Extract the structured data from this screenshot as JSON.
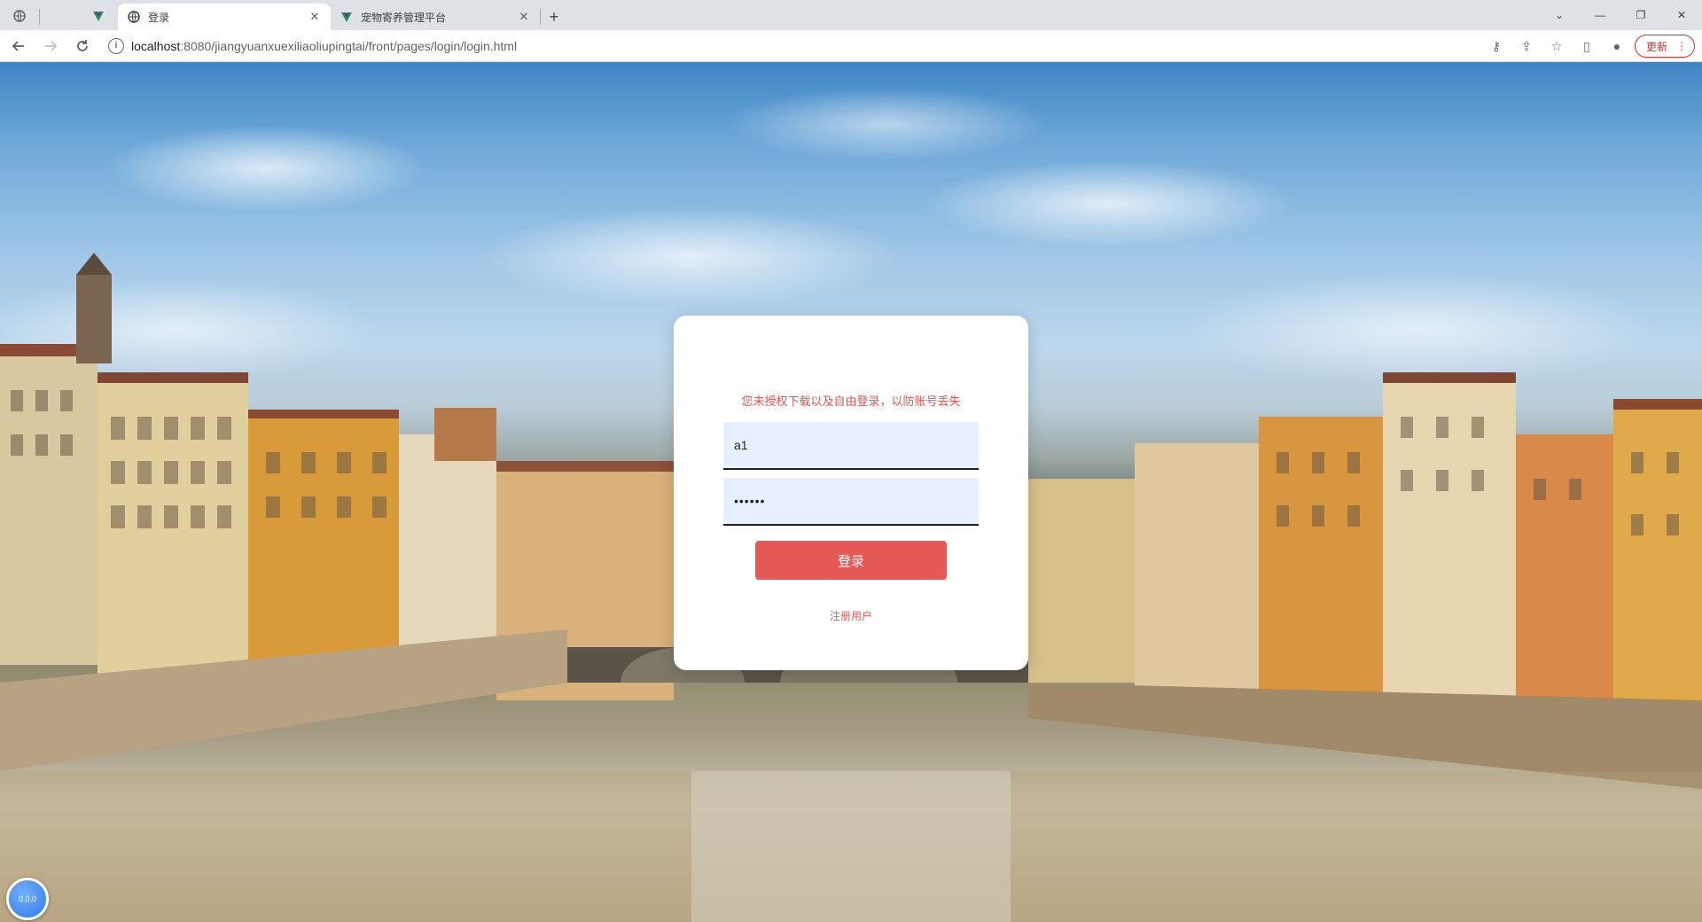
{
  "browser": {
    "tabs": [
      {
        "title": "",
        "icon": "globe-icon",
        "pinned": true
      },
      {
        "title": "",
        "icon": "blank-icon",
        "pinned": true
      },
      {
        "title": "登录",
        "icon": "globe-icon",
        "active": true
      },
      {
        "title": "宠物寄养管理平台",
        "icon": "vue-icon",
        "active": false
      }
    ],
    "new_tab": "+",
    "url_host": "localhost",
    "url_path": ":8080/jiangyuanxuexiliaoliupingtai/front/pages/login/login.html",
    "update_label": "更新"
  },
  "login": {
    "notice": "您未授权下载以及自由登录，以防账号丢失",
    "username_value": "a1",
    "password_value": "••••••",
    "submit_label": "登录",
    "register_label": "注册用户"
  },
  "float_badge": {
    "label": "0.0.0"
  },
  "colors": {
    "accent": "#e55a57",
    "input_bg": "#e8f0fe",
    "card_bg": "#ffffff"
  }
}
